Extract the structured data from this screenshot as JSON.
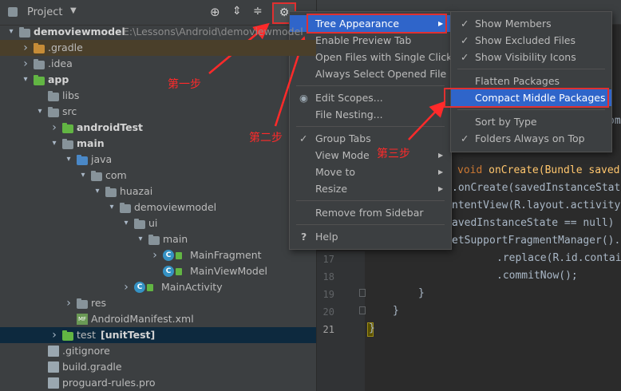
{
  "panel": {
    "title": "Project",
    "tree": [
      {
        "label": "demoviewmodel",
        "path": "E:\\Lessons\\Android\\demoviewmodel",
        "indent": 0,
        "arrow": "down",
        "icon": "folder-gray",
        "bold": true
      },
      {
        "label": ".gradle",
        "indent": 1,
        "arrow": "right",
        "icon": "folder-orange"
      },
      {
        "label": ".idea",
        "indent": 1,
        "arrow": "right",
        "icon": "folder-gray"
      },
      {
        "label": "app",
        "indent": 1,
        "arrow": "down",
        "icon": "folder-green",
        "bold": true
      },
      {
        "label": "libs",
        "indent": 2,
        "arrow": "",
        "icon": "folder-gray"
      },
      {
        "label": "src",
        "indent": 2,
        "arrow": "down",
        "icon": "folder-gray"
      },
      {
        "label": "androidTest",
        "indent": 3,
        "arrow": "right",
        "icon": "folder-green",
        "bold": true
      },
      {
        "label": "main",
        "indent": 3,
        "arrow": "down",
        "icon": "folder-gray",
        "bold": true
      },
      {
        "label": "java",
        "indent": 4,
        "arrow": "down",
        "icon": "folder-blue"
      },
      {
        "label": "com",
        "indent": 5,
        "arrow": "down",
        "icon": "folder-gray"
      },
      {
        "label": "huazai",
        "indent": 6,
        "arrow": "down",
        "icon": "folder-gray"
      },
      {
        "label": "demoviewmodel",
        "indent": 7,
        "arrow": "down",
        "icon": "folder-gray"
      },
      {
        "label": "ui",
        "indent": 8,
        "arrow": "down",
        "icon": "folder-gray"
      },
      {
        "label": "main",
        "indent": 9,
        "arrow": "down",
        "icon": "folder-gray"
      },
      {
        "label": "MainFragment",
        "indent": 10,
        "arrow": "right",
        "icon": "class"
      },
      {
        "label": "MainViewModel",
        "indent": 10,
        "arrow": "",
        "icon": "class"
      },
      {
        "label": "MainActivity",
        "indent": 8,
        "arrow": "right",
        "icon": "class"
      },
      {
        "label": "res",
        "indent": 4,
        "arrow": "right",
        "icon": "folder-gray"
      },
      {
        "label": "AndroidManifest.xml",
        "indent": 4,
        "arrow": "",
        "icon": "manifest"
      },
      {
        "label": "test",
        "suffix": "[unitTest]",
        "indent": 3,
        "arrow": "right",
        "icon": "folder-green",
        "selected": true
      },
      {
        "label": ".gitignore",
        "indent": 2,
        "arrow": "",
        "icon": "file"
      },
      {
        "label": "build.gradle",
        "indent": 2,
        "arrow": "",
        "icon": "file"
      },
      {
        "label": "proguard-rules.pro",
        "indent": 2,
        "arrow": "",
        "icon": "file"
      }
    ]
  },
  "editor": {
    "lines": [
      {
        "num": "",
        "code": "void onCreate(Bundle saved"
      },
      {
        "num": "",
        "code": ".onCreate(savedInstanceStat"
      },
      {
        "num": "",
        "code": "ntentView(R.layout.activity"
      },
      {
        "num": "",
        "code": "avedInstanceState == null)"
      },
      {
        "num": "",
        "code": "etSupportFragmentManager()."
      },
      {
        "num": "17",
        "code": ".replace(R.id.contai"
      },
      {
        "num": "18",
        "code": ".commitNow();"
      },
      {
        "num": "19",
        "code": "}"
      },
      {
        "num": "20",
        "code": "}"
      },
      {
        "num": "21",
        "code": "}"
      }
    ],
    "fragment_om": "om"
  },
  "gear_menu": {
    "items": [
      {
        "label": "Tree Appearance",
        "submenu": true,
        "highlight": true
      },
      {
        "label": "Enable Preview Tab"
      },
      {
        "label": "Open Files with Single Click"
      },
      {
        "label": "Always Select Opened File"
      },
      {
        "sep": true
      },
      {
        "label": "Edit Scopes...",
        "icon": "radio"
      },
      {
        "label": "File Nesting..."
      },
      {
        "sep": true
      },
      {
        "label": "Group Tabs",
        "check": true
      },
      {
        "label": "View Mode",
        "submenu": true
      },
      {
        "label": "Move to",
        "submenu": true
      },
      {
        "label": "Resize",
        "submenu": true
      },
      {
        "sep": true
      },
      {
        "label": "Remove from Sidebar"
      },
      {
        "sep": true
      },
      {
        "label": "Help",
        "icon": "question"
      }
    ]
  },
  "tree_menu": {
    "items": [
      {
        "label": "Show Members",
        "check": true
      },
      {
        "label": "Show Excluded Files",
        "check": true
      },
      {
        "label": "Show Visibility Icons",
        "check": true
      },
      {
        "sep": true
      },
      {
        "label": "Flatten Packages"
      },
      {
        "label": "Compact Middle Packages",
        "highlight": true
      },
      {
        "sep": true
      },
      {
        "label": "Sort by Type"
      },
      {
        "label": "Folders Always on Top",
        "check": true
      }
    ]
  },
  "annotations": {
    "step1": "第一步",
    "step2": "第二步",
    "step3": "第三步"
  },
  "colors": {
    "accent": "#2f65ca",
    "annotation": "#ff2a2a",
    "panel_bg": "#3c3f41",
    "editor_bg": "#2b2b2b"
  }
}
